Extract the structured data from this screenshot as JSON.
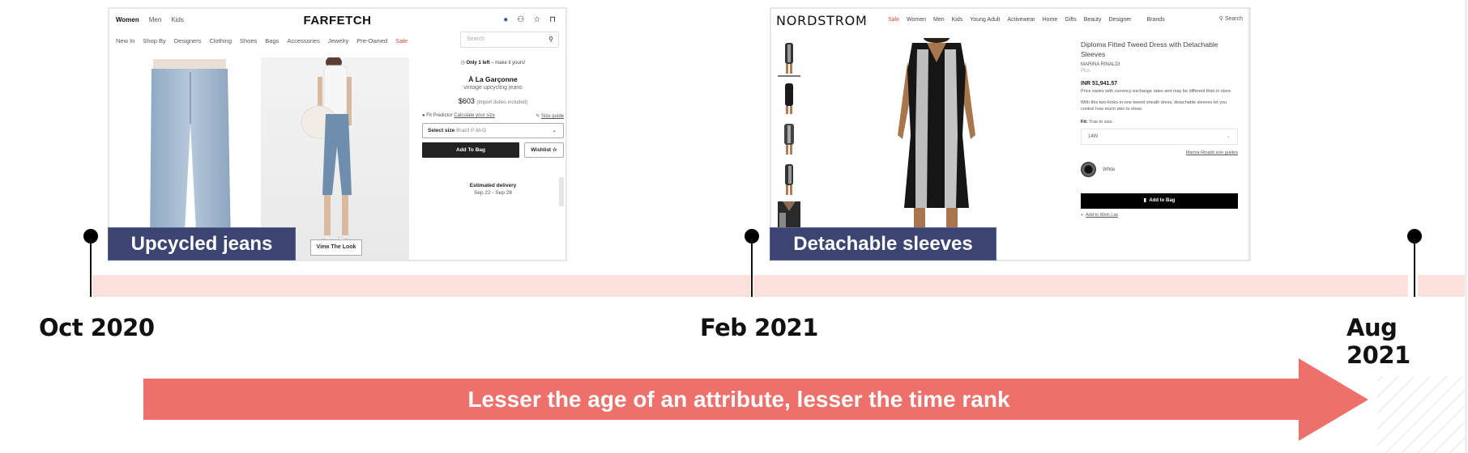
{
  "farfetch": {
    "logo": "FARFETCH",
    "top_tabs": [
      "Women",
      "Men",
      "Kids"
    ],
    "icons": [
      "flag-icon",
      "account-icon",
      "wishlist-star-icon",
      "bag-icon"
    ],
    "nav": [
      "New In",
      "Shop By",
      "Designers",
      "Clothing",
      "Shoes",
      "Bags",
      "Accessories",
      "Jewelry",
      "Pre-Owned",
      "Sale"
    ],
    "search_placeholder": "Search",
    "view_the_look": "View The Look",
    "availability_bold": "Only 1 left",
    "availability_rest": " – make it yours!",
    "brand": "À La Garçonne",
    "product_desc": "vintage upcycling jeans",
    "price": "$603",
    "price_note": "(Import duties included)",
    "fit_predictor": "Fit Predictor",
    "calc_size": "Calculate your size",
    "size_guide": "Size guide",
    "select_size_label": "Select size",
    "select_size_value": "Brazil P-M-G",
    "add_to_bag": "Add To Bag",
    "wishlist": "Wishlist",
    "estimated_delivery": "Estimated delivery",
    "delivery_dates": "Sep 22 - Sep 28"
  },
  "nordstrom": {
    "logo": "NORDSTROM",
    "nav": [
      "Sale",
      "Women",
      "Men",
      "Kids",
      "Young Adult",
      "Activewear",
      "Home",
      "Gifts",
      "Beauty",
      "Designer",
      "Brands"
    ],
    "search_label": "Search",
    "product_title": "Diploma Fitted Tweed Dress with Detachable Sleeves",
    "brand": "MARINA RINALDI",
    "size_type": "Plus",
    "price": "INR 51,941.57",
    "price_note": "Price varies with currency exchange rates and may be different than in store.",
    "description": "With this two-looks-in-one tweed sheath dress, detachable sleeves let you control how much skin to show.",
    "fit_label": "Fit:",
    "fit_value": "True to size.",
    "size_value": "14W",
    "size_guide": "Marina Rinaldi size guides",
    "color": "White",
    "add_to_bag": "Add to Bag",
    "add_to_wishlist": "Add to Wish List",
    "thumbnail_count": 5
  },
  "captions": {
    "first": "Upcycled jeans",
    "second": "Detachable sleeves"
  },
  "timeline": {
    "dates": [
      "Oct 2020",
      "Feb 2021",
      "Aug 2021"
    ]
  },
  "arrow": {
    "label": "Lesser the age of an attribute, lesser the time rank"
  },
  "colors": {
    "caption_bg": "#3c4571",
    "band": "#fbe0dc",
    "arrow": "#ed706a"
  }
}
